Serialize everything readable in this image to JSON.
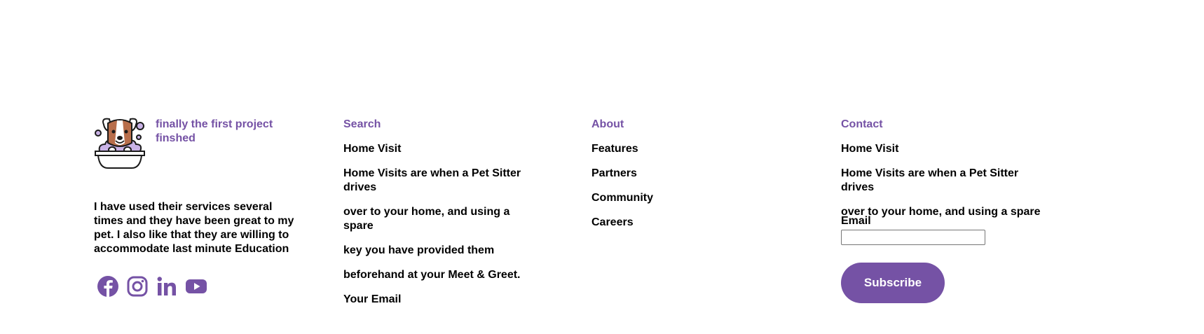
{
  "brand": {
    "title": "finally the first project finshed",
    "logo_icon": "dog-in-bathtub-icon",
    "testimonial": "I have used their services several times and they have been great to my pet. I also like that they are willing to accommodate last minute Education"
  },
  "socials": [
    {
      "icon": "facebook-icon"
    },
    {
      "icon": "instagram-icon"
    },
    {
      "icon": "linkedin-icon"
    },
    {
      "icon": "youtube-icon"
    }
  ],
  "columns": {
    "search": {
      "heading": "Search",
      "items": [
        "Home Visit",
        "Home Visits are when a Pet Sitter drives",
        "over to your home, and using a spare",
        "key you have provided them",
        "beforehand at your Meet & Greet.",
        "Your Email"
      ]
    },
    "about": {
      "heading": "About",
      "items": [
        "Features",
        "Partners",
        "Community",
        "Careers"
      ]
    },
    "contact": {
      "heading": "Contact",
      "items": [
        "Home Visit",
        "Home Visits are when a Pet Sitter drives",
        "over to your home, and using a spare"
      ],
      "email_label": "Email",
      "email_value": "",
      "subscribe_label": "Subscribe"
    }
  },
  "colors": {
    "accent": "#7552a5",
    "text": "#000000",
    "background": "#ffffff"
  }
}
